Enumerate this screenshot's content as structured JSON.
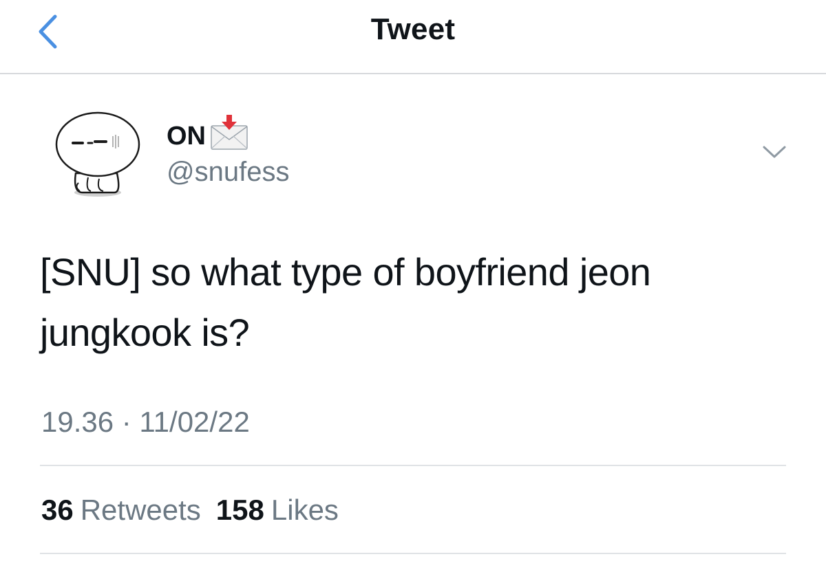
{
  "navbar": {
    "title": "Tweet",
    "back_icon": "chevron-left-icon",
    "accent_color": "#4a90e2"
  },
  "author": {
    "display_name": "ON",
    "name_emoji": "envelope-with-arrow-icon",
    "handle": "@snufess",
    "avatar": "cartoon-character-avatar"
  },
  "tweet": {
    "lines": [
      "[SNU] so what type of boyfriend jeon",
      "jungkook is?"
    ],
    "timestamp": "19.36 · 11/02/22"
  },
  "stats": {
    "retweets_count": "36",
    "retweets_label": "Retweets",
    "likes_count": "158",
    "likes_label": "Likes"
  },
  "colors": {
    "text_primary": "#0f1419",
    "text_secondary": "#6b7883",
    "divider": "#dfe2e5"
  }
}
